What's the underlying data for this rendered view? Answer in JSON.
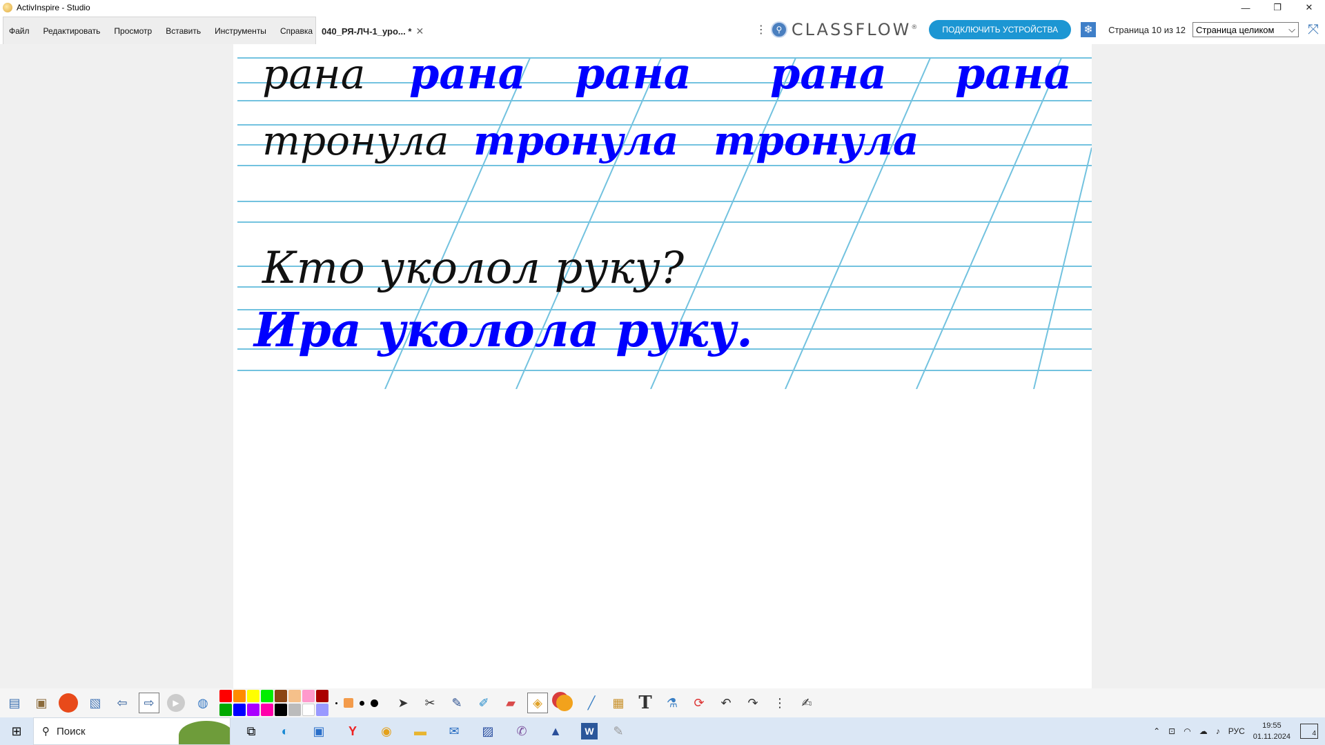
{
  "window": {
    "title": "ActivInspire - Studio",
    "controls": {
      "minimize": "—",
      "restore": "❐",
      "close": "✕"
    }
  },
  "menu": {
    "items": [
      {
        "id": "file",
        "label": "Файл"
      },
      {
        "id": "edit",
        "label": "Редактировать"
      },
      {
        "id": "view",
        "label": "Просмотр"
      },
      {
        "id": "insert",
        "label": "Вставить"
      },
      {
        "id": "tools",
        "label": "Инструменты"
      },
      {
        "id": "help",
        "label": "Справка"
      }
    ]
  },
  "document_tab": {
    "label": "040_РЯ-ЛЧ-1_уро... *",
    "close": "✕"
  },
  "header": {
    "brand": "CLASSFLOW",
    "brand_mark": "®",
    "connect_button": "ПОДКЛЮЧИТЬ УСТРОЙСТВА",
    "page_info": "Страница 10 из 12",
    "zoom_select": "Страница целиком"
  },
  "colors": {
    "accent": "#1c96d3",
    "ink_black": "#111111",
    "ink_blue": "#0000ff",
    "ruling": "#72c2df"
  },
  "canvas": {
    "lines": [
      {
        "sample": "рана",
        "copies": [
          "рана",
          "рана",
          "рана",
          "рана"
        ]
      },
      {
        "sample": "тронула",
        "copies": [
          "тронула",
          "тронула"
        ]
      },
      {
        "sample": "Кто уколол руку?",
        "copies": []
      },
      {
        "sample": "",
        "copies": [
          "Ира уколола руку."
        ]
      }
    ]
  },
  "toolbar": {
    "palette": [
      "#ff0000",
      "#ff8c00",
      "#ffff00",
      "#00ee00",
      "#8b4513",
      "#f5c08a",
      "#ff99cc",
      "#aa0000",
      "#00aa00",
      "#0000ff",
      "#aa00ff",
      "#ff00aa",
      "#000000",
      "#bbbbbb",
      "#ffffff",
      "#9999ff"
    ],
    "icons": [
      "browsers-icon",
      "user-icon",
      "pen-red-icon",
      "photo-icon",
      "prev-page-icon",
      "next-page-icon",
      "play-icon",
      "globe-icon",
      "select-arrow-icon",
      "tools-icon",
      "pen-icon",
      "highlighter-icon",
      "eraser-icon",
      "fill-icon",
      "shapes-icon",
      "connector-icon",
      "clipboard-icon",
      "text-icon",
      "spray-icon",
      "reset-icon",
      "undo-icon",
      "redo-icon",
      "more-icon",
      "dock-icon"
    ]
  },
  "taskbar": {
    "search_placeholder": "Поиск",
    "language": "РУС",
    "time": "19:55",
    "date": "01.11.2024",
    "notifications": "4"
  }
}
